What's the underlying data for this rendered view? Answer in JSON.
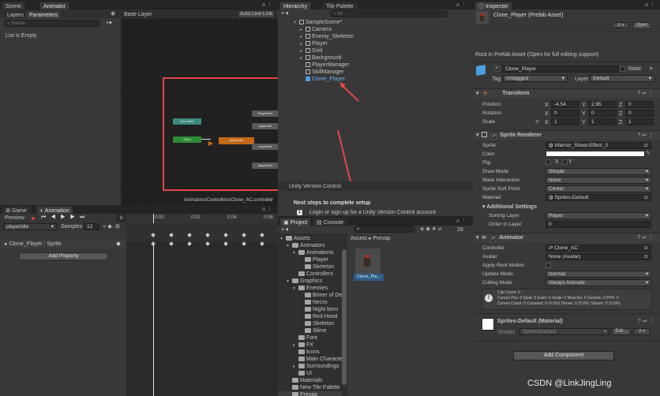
{
  "scene": {
    "tab_scene": "Scene",
    "tab_animator": "Animator",
    "sub_layers": "Layers",
    "sub_parameters": "Parameters",
    "search_placeholder": "Name",
    "list_empty": "List is Empty",
    "layer_title": "Base Layer",
    "auto_live": "Auto Live Link",
    "nodes": [
      {
        "label": "Any State"
      },
      {
        "label": "Entry"
      },
      {
        "label": "playerIdle"
      },
      {
        "label": "PlayerRun"
      },
      {
        "label": "playerAtk"
      },
      {
        "label": "playerDie"
      },
      {
        "label": "playerHurt"
      }
    ],
    "path": "Animators/Controllers/Clone_AC.controller"
  },
  "hierarchy": {
    "tab": "Hierarchy",
    "tab2": "Tile Palette",
    "search_placeholder": "All",
    "scene": "SampleScene*",
    "items": [
      "Camera",
      "Enemy_Skeleton",
      "Player",
      "Grid",
      "Background",
      "PlayerManager",
      "SkillManager",
      "Clone_Player"
    ]
  },
  "uvc": {
    "title": "Unity Version Control",
    "next_steps": "Next steps to complete setup",
    "step1": "Login or sign up for a Unity Version Control account"
  },
  "animation": {
    "tab_game": "Game",
    "tab_animation": "Animation",
    "preview": "Preview",
    "frame": "0",
    "clip": "playerIdle",
    "samples_label": "Samples",
    "samples": "12",
    "ticks": [
      "0:00",
      "0:02",
      "0:04",
      "0:06"
    ],
    "property": "Clone_Player : Sprite",
    "add_property": "Add Property"
  },
  "project": {
    "tab_project": "Project",
    "tab_console": "Console",
    "count": "28",
    "breadcrumb_assets": "Assets",
    "breadcrumb_prevap": "Prevap",
    "tree": [
      {
        "label": "Assets",
        "depth": 0,
        "open": true
      },
      {
        "label": "Animators",
        "depth": 1,
        "open": true
      },
      {
        "label": "Animations",
        "depth": 2,
        "open": true
      },
      {
        "label": "Player",
        "depth": 3
      },
      {
        "label": "Skeleton",
        "depth": 3
      },
      {
        "label": "Controllers",
        "depth": 2
      },
      {
        "label": "Graphics",
        "depth": 1,
        "open": true
      },
      {
        "label": "Enemies",
        "depth": 2,
        "open": true
      },
      {
        "label": "Briner of Dea",
        "depth": 3
      },
      {
        "label": "Necro",
        "depth": 3
      },
      {
        "label": "Night born",
        "depth": 3
      },
      {
        "label": "Red Hood",
        "depth": 3
      },
      {
        "label": "Skeleton",
        "depth": 3
      },
      {
        "label": "Slime",
        "depth": 3
      },
      {
        "label": "Font",
        "depth": 2
      },
      {
        "label": "FX",
        "depth": 2,
        "closed": true
      },
      {
        "label": "Icons",
        "depth": 2
      },
      {
        "label": "Main Characte",
        "depth": 2
      },
      {
        "label": "Surroundings",
        "depth": 2,
        "closed": true
      },
      {
        "label": "UI",
        "depth": 2
      },
      {
        "label": "Materials",
        "depth": 1
      },
      {
        "label": "New Tile Palette",
        "depth": 1
      },
      {
        "label": "Prevap",
        "depth": 1,
        "selected": true
      }
    ],
    "asset": "Clone_Pla..."
  },
  "inspector": {
    "tab": "Inspector",
    "title": "Clone_Player (Prefab Asset)",
    "open": "Open",
    "root_msg": "Root in Prefab Asset (Open for full editing support)",
    "name": "Clone_Player",
    "static": "Static",
    "tag_label": "Tag",
    "tag": "Untagged",
    "layer_label": "Layer",
    "layer": "Default",
    "transform": {
      "title": "Transform",
      "position": "Position",
      "rotation": "Rotation",
      "scale": "Scale",
      "pos": [
        "-4.54",
        "2.95",
        "0"
      ],
      "rot": [
        "0",
        "0",
        "0"
      ],
      "scl": [
        "1",
        "1",
        "1"
      ]
    },
    "sprite_renderer": {
      "title": "Sprite Renderer",
      "sprite_label": "Sprite",
      "sprite": "Warrior_Sheet-Effect_0",
      "color_label": "Color",
      "flip_label": "Flip",
      "flip_x": "X",
      "flip_y": "Y",
      "draw_mode_label": "Draw Mode",
      "draw_mode": "Simple",
      "mask_label": "Mask Interaction",
      "mask": "None",
      "pivot_label": "Sprite Sort Point",
      "pivot": "Center",
      "material_label": "Material",
      "material": "Sprites-Default",
      "additional": "Additional Settings",
      "sorting_label": "Sorting Layer",
      "sorting": "Player",
      "order_label": "Order in Layer",
      "order": "0"
    },
    "animator": {
      "title": "Animator",
      "controller_label": "Controller",
      "controller": "Clone_AC",
      "avatar_label": "Avatar",
      "avatar": "None (Avatar)",
      "root_motion": "Apply Root Motion",
      "update_label": "Update Mode",
      "update": "Normal",
      "culling_label": "Culling Mode",
      "culling": "Always Animate",
      "info1": "Clip Count: 0",
      "info2": "Curves Pos: 0 Quat: 0 Euler: 0 Scale: 0 Muscles: 0 Generic: 0 PPtr: 0",
      "info3": "Curves Count: 0 Constant: 0 (0.0%) Dense: 0 (0.0%) Stream: 0 (0.0%)"
    },
    "material": {
      "title": "Sprites-Default (Material)",
      "shader_label": "Shader",
      "shader": "Sprites/Default",
      "edit": "Edit..."
    },
    "add_component": "Add Component"
  },
  "watermark": "CSDN @LinkJingLing",
  "colors": {
    "highlight": "#e04848",
    "selection": "#2c5d87",
    "accent": "#3a79bb",
    "orange": "#c36a18",
    "teal": "#3c8a7e",
    "green": "#2e8b36"
  }
}
